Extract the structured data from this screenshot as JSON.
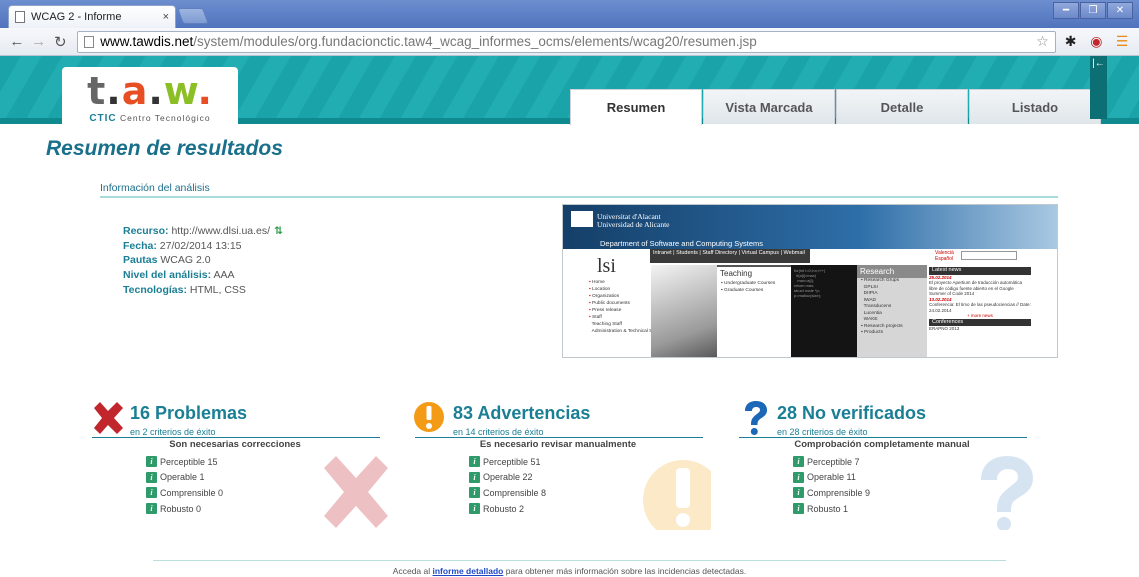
{
  "browser": {
    "tab_title": "WCAG 2 - Informe",
    "tab_close": "×",
    "url_host": "www.tawdis.net",
    "url_path": "/system/modules/org.fundacionctic.taw4_wcag_informes_ocms/elements/wcag20/resumen.jsp",
    "icons": [
      "back-arrow-icon",
      "forward-arrow-icon",
      "reload-icon",
      "page-icon",
      "star-icon",
      "gear-icon",
      "extension-icon",
      "menu-icon"
    ]
  },
  "header": {
    "logo_text": "t.a.w.",
    "logo_sub_brand": "CTIC",
    "logo_sub_text": "Centro Tecnológico",
    "tabs": [
      {
        "label": "Resumen",
        "active": true
      },
      {
        "label": "Vista Marcada",
        "active": false
      },
      {
        "label": "Detalle",
        "active": false
      },
      {
        "label": "Listado",
        "active": false
      }
    ],
    "collapse_glyph": "|←"
  },
  "main": {
    "title": "Resumen de resultados",
    "section_title": "Información del análisis",
    "info": {
      "recurso_label": "Recurso:",
      "recurso_value": "http://www.dlsi.ua.es/",
      "fecha_label": "Fecha:",
      "fecha_value": "27/02/2014 13:15",
      "pautas_label": "Pautas",
      "pautas_value": "WCAG 2.0",
      "nivel_label": "Nivel del análisis:",
      "nivel_value": "AAA",
      "tecnologias_label": "Tecnologías:",
      "tecnologias_value": "HTML, CSS"
    },
    "thumbnail": {
      "uni_line1": "Universitat d'Alacant",
      "uni_line2": "Universidad de Alicante",
      "dept": "Department of Software and Computing Systems",
      "menu": "Intranet | Students | Staff Directory | Virtual Campus | Webmail",
      "lang_1": "Valencià",
      "lang_2": "Español",
      "lsi": "lsi",
      "side": [
        "Home",
        "Location",
        "Organization",
        "Public documents",
        "Press release",
        "Staff",
        "Teaching Staff",
        "Administration & Technical Staff"
      ],
      "teaching_title": "Teaching",
      "teaching_items": [
        "Undergraduate Courses",
        "Graduate Courses"
      ],
      "research_title": "Research",
      "research_items": [
        "Research Grups",
        "GPLSI",
        "DIIPIA",
        "IWAD",
        "Transducens",
        "Lucentia",
        "WAKE",
        "Research projects",
        "Products"
      ],
      "news_title": "Latest news",
      "news": [
        {
          "date": "25.02.2014",
          "text": "El proyecto Apertium de traducción automática libre de código fuente abierto en el Google Summer of Code 2014"
        },
        {
          "date": "13.02.2014",
          "text": "Conferencia: El timo de las pseudociencias // Date: 24.02.2014"
        }
      ],
      "more": "+ more news",
      "conf_title": "Conferences",
      "conf_item": "ERAPNO 2013"
    },
    "results": [
      {
        "kind": "problems",
        "count": "16 Problemas",
        "sub": "en 2 criterios de éxito",
        "heading": "Son necesarias correcciones",
        "color": "#c0262b",
        "items": [
          "Perceptible 15",
          "Operable 1",
          "Comprensible 0",
          "Robusto 0"
        ]
      },
      {
        "kind": "warnings",
        "count": "83 Advertencias",
        "sub": "en 14 criterios de éxito",
        "heading": "Es necesario revisar manualmente",
        "color": "#f39a16",
        "items": [
          "Perceptible 51",
          "Operable 22",
          "Comprensible 8",
          "Robusto 2"
        ]
      },
      {
        "kind": "unverified",
        "count": "28 No verificados",
        "sub": "en 28 criterios de éxito",
        "heading": "Comprobación completamente manual",
        "color": "#1b67b8",
        "items": [
          "Perceptible 7",
          "Operable 11",
          "Comprensible 9",
          "Robusto 1"
        ]
      }
    ],
    "item_icon_glyph": "i",
    "footer": {
      "prefix": "Acceda al ",
      "link": "informe detallado",
      "suffix": " para obtener más información sobre las incidencias detectadas."
    }
  }
}
